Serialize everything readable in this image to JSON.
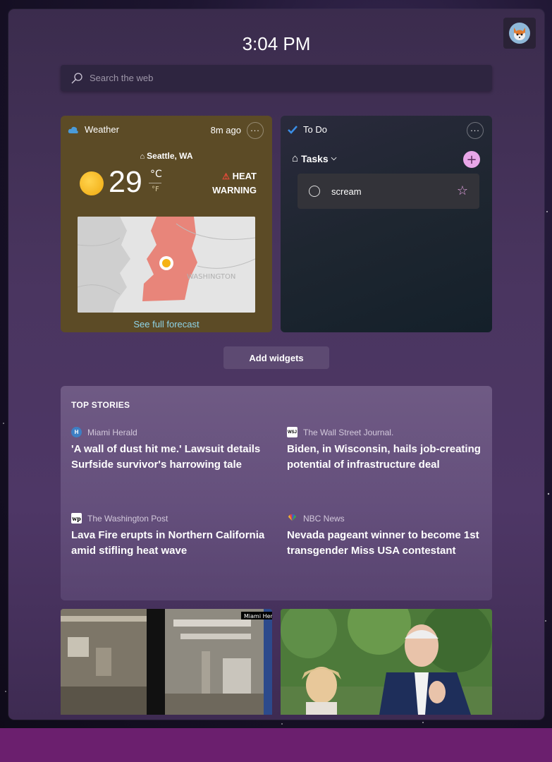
{
  "clock": "3:04 PM",
  "search": {
    "placeholder": "Search the web"
  },
  "weather": {
    "title": "Weather",
    "updated": "8m ago",
    "location": "Seattle, WA",
    "temperature": "29",
    "unit_c": "°C",
    "unit_f": "°F",
    "alert_line1": "HEAT",
    "alert_line2": "WARNING",
    "map_label": "WASHINGTON",
    "forecast_link": "See full forecast"
  },
  "todo": {
    "title": "To Do",
    "list_name": "Tasks",
    "tasks": [
      {
        "text": "scream",
        "starred": false
      }
    ]
  },
  "add_widgets": "Add widgets",
  "top_stories": {
    "heading": "TOP STORIES",
    "items": [
      {
        "source": "Miami Herald",
        "title": "'A wall of dust hit me.' Lawsuit details Surfside survivor's harrowing tale"
      },
      {
        "source": "The Wall Street Journal.",
        "title": "Biden, in Wisconsin, hails job-creating potential of infrastructure deal"
      },
      {
        "source": "The Washington Post",
        "title": "Lava Fire erupts in Northern California amid stifling heat wave"
      },
      {
        "source": "NBC News",
        "title": "Nevada pageant winner to become 1st transgender Miss USA contestant"
      }
    ]
  },
  "image_cards": [
    {
      "watermark": "Miami Hera"
    }
  ],
  "colors": {
    "weather_bg": "#5c4b26",
    "accent_pink": "#e8a6e8",
    "link_cyan": "#8fd4e8",
    "taskbar": "#6b1f6e"
  }
}
